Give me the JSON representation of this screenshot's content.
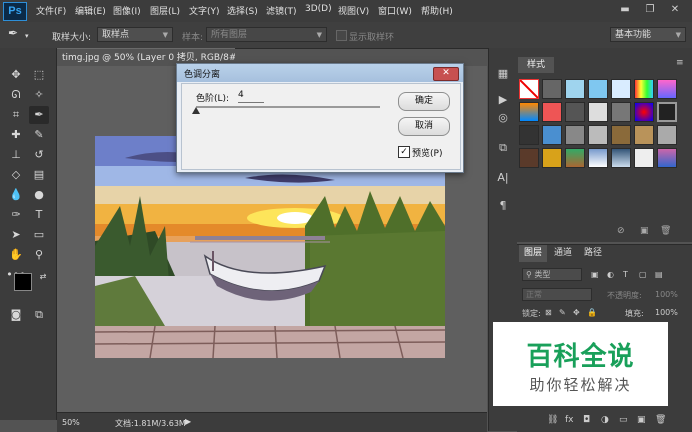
{
  "app": {
    "logo": "Ps",
    "menu": [
      "文件(F)",
      "编辑(E)",
      "图像(I)",
      "图层(L)",
      "文字(Y)",
      "选择(S)",
      "滤镜(T)",
      "3D(D)",
      "视图(V)",
      "窗口(W)",
      "帮助(H)"
    ]
  },
  "options": {
    "sample_size_label": "取样大小:",
    "sample_size_value": "取样点",
    "sample_label": "样本:",
    "sample_value": "所有图层",
    "show_ring_label": "显示取样环",
    "workspace": "基本功能"
  },
  "document": {
    "tab_title": "timg.jpg @ 50% (Layer 0 拷贝, RGB/8#) *",
    "zoom": "50%",
    "doc_info": "文档:1.81M/3.63M"
  },
  "dialog": {
    "title": "色调分离",
    "close": "✕",
    "levels_label": "色阶(L):",
    "levels_value": "4",
    "ok": "确定",
    "cancel": "取消",
    "preview": "预览(P)"
  },
  "styles_panel": {
    "tab": "样式"
  },
  "layers_panel": {
    "tabs": [
      "图层",
      "通道",
      "路径"
    ],
    "kind": "类型",
    "blend_mode": "正常",
    "opacity_label": "不透明度:",
    "opacity_value": "100%",
    "lock_label": "锁定:",
    "fill_label": "填充:",
    "fill_value": "100%"
  },
  "watermark": {
    "title": "百科全说",
    "subtitle": "助你轻松解决"
  },
  "colors": {
    "app_bg": "#535353",
    "panel": "#3c3c3c",
    "watermark_green": "#19a05a",
    "ps_blue": "#36a3f0"
  }
}
